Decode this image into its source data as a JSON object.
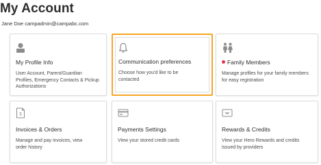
{
  "page": {
    "title": "My Account",
    "user_line": "Jane Doe campadmin@campabc.com"
  },
  "colors": {
    "highlight_border": "#f5a623",
    "notification_dot": "#e8334a",
    "icon_gray": "#8c8c8c"
  },
  "cards": [
    {
      "title": "My Profile Info",
      "description": "User Account, Parent/Guardian Profiles, Emergency Contacts & Pickup Authorizations",
      "icon": "person-icon"
    },
    {
      "title": "Communication preferences",
      "description": "Choose how you'd like to be contacted",
      "icon": "bell-icon",
      "highlighted": true
    },
    {
      "title": "Family Members",
      "description": "Manage profiles for your family members for easy registration",
      "icon": "family-icon",
      "has_notification_dot": true
    },
    {
      "title": "Invoices & Orders",
      "description": "Manage and pay invoices, view order history",
      "icon": "invoice-icon"
    },
    {
      "title": "Payments Settings",
      "description": "View your stored credit cards",
      "icon": "credit-card-icon"
    },
    {
      "title": "Rewards & Credits",
      "description": "View your Hero Rewards and credits issued by providers",
      "icon": "rewards-card-icon"
    }
  ]
}
